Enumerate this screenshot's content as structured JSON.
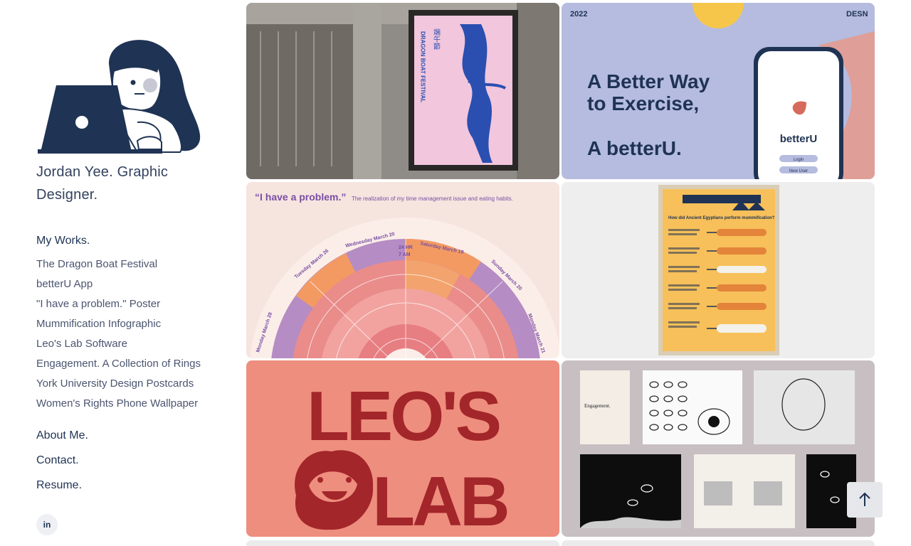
{
  "site": {
    "title": "Jordan Yee. Graphic Designer.",
    "nav_works": "My Works.",
    "nav_about": "About Me.",
    "nav_contact": "Contact.",
    "nav_resume": "Resume.",
    "social_linkedin": "in"
  },
  "works": [
    "The Dragon Boat Festival",
    "betterU App",
    "\"I have a problem.\" Poster",
    "Mummification Infographic",
    "Leo's Lab Software",
    "Engagement. A Collection of Rings",
    "York University Design Postcards",
    "Women's Rights Phone Wallpaper"
  ],
  "tiles": {
    "dragon": {
      "vertical_text": "DRAGON BOAT FESTIVAL",
      "chinese": "端午節"
    },
    "betteru": {
      "year": "2022",
      "corner": "DESN",
      "line1": "A Better Way",
      "line2": "to Exercise,",
      "line3": "A betterU.",
      "app_name": "betterU",
      "login": "Login",
      "new_user": "New User"
    },
    "problem": {
      "headline": "“I have a problem.”",
      "subhead": "The realization of my time management issue and eating habits.",
      "time": "24 HR",
      "time2": "7 AM",
      "day1": "Wednesday March 20",
      "day2": "Saturday March 19",
      "day3": "Tuesday March 26",
      "day4": "Sunday March 20",
      "day5": "Monday March 28",
      "day6": "Monday March 21"
    },
    "mummy": {
      "question": "How did Ancient Egyptians perform mummification?"
    },
    "leo": {
      "line1": "LEO'S",
      "line2": "LAB"
    },
    "rings": {
      "title": "Engagement."
    }
  },
  "colors": {
    "navy": "#1f3354",
    "betteru_bg": "#b5bcdf",
    "leo_bg": "#ee8e7e",
    "leo_red": "#a3262a",
    "problem_bg": "#f6e4df",
    "mummy_bg": "#eeeeee",
    "rings_bg": "#c7bfc1"
  },
  "icons": {
    "scroll_top": "arrow-up-icon"
  }
}
